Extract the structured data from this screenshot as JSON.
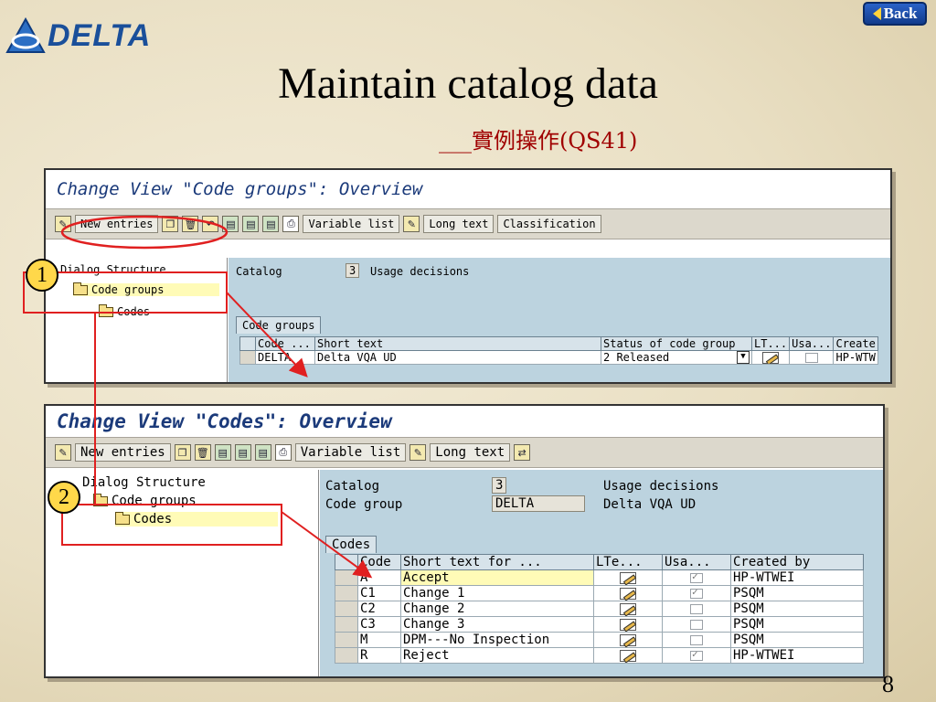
{
  "logo": {
    "text": "DELTA",
    "color": "#1a4f9a"
  },
  "back_button": {
    "label": "Back"
  },
  "slide": {
    "title": "Maintain catalog data",
    "subtitle": "___實例操作(QS41)",
    "page_number": "8",
    "markers": [
      "1",
      "2"
    ],
    "annotation_color": "#e02020"
  },
  "screen1": {
    "title": "Change View \"Code groups\": Overview",
    "toolbar": {
      "new_entries": "New entries",
      "variable_list": "Variable list",
      "long_text": "Long text",
      "classification": "Classification"
    },
    "tree": {
      "header": "Dialog Structure",
      "items": [
        "Code groups",
        "Codes"
      ]
    },
    "fields": {
      "catalog_label": "Catalog",
      "catalog_value": "3",
      "catalog_text": "Usage decisions"
    },
    "tab": "Code groups",
    "columns": [
      "Code ...",
      "Short text",
      "Status of code group",
      "LT...",
      "Usa...",
      "Create"
    ],
    "rows": [
      {
        "code": "DELTA",
        "short_text": "Delta VQA UD",
        "status": "2 Released",
        "created": "HP-WTW"
      }
    ]
  },
  "screen2": {
    "title": "Change View \"Codes\": Overview",
    "toolbar": {
      "new_entries": "New entries",
      "variable_list": "Variable list",
      "long_text": "Long text"
    },
    "tree": {
      "header": "Dialog Structure",
      "items": [
        "Code groups",
        "Codes"
      ]
    },
    "fields": {
      "catalog_label": "Catalog",
      "catalog_value": "3",
      "catalog_text": "Usage decisions",
      "codegroup_label": "Code group",
      "codegroup_value": "DELTA",
      "codegroup_text": "Delta VQA UD"
    },
    "tab": "Codes",
    "columns": [
      "Code",
      "Short text for ...",
      "LTe...",
      "Usa...",
      "Created by"
    ],
    "rows": [
      {
        "code": "A",
        "short_text": "Accept",
        "usage": true,
        "created": "HP-WTWEI"
      },
      {
        "code": "C1",
        "short_text": "Change 1",
        "usage": true,
        "created": "PSQM"
      },
      {
        "code": "C2",
        "short_text": "Change 2",
        "usage": false,
        "created": "PSQM"
      },
      {
        "code": "C3",
        "short_text": "Change 3",
        "usage": false,
        "created": "PSQM"
      },
      {
        "code": "M",
        "short_text": "DPM---No Inspection",
        "usage": false,
        "created": "PSQM"
      },
      {
        "code": "R",
        "short_text": "Reject",
        "usage": true,
        "created": "HP-WTWEI"
      }
    ]
  }
}
